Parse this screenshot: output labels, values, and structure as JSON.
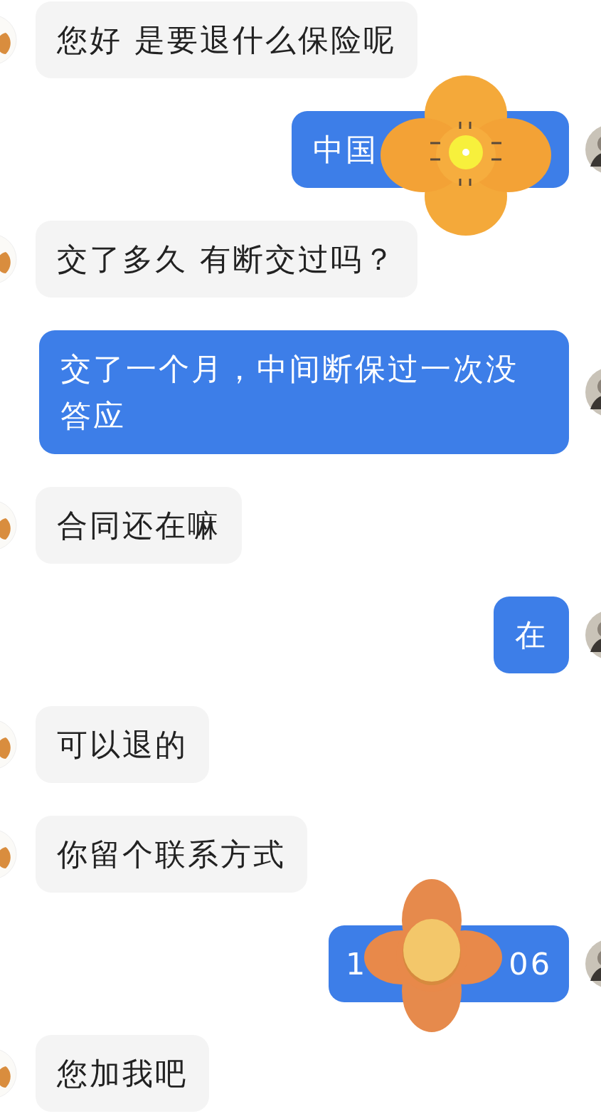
{
  "messages": [
    {
      "kind": "incoming",
      "parts": [
        "您好 是要退什么保险呢"
      ]
    },
    {
      "kind": "outgoing",
      "parts": [
        "中国"
      ],
      "sticker": {
        "kind": "sketch"
      }
    },
    {
      "kind": "incoming",
      "parts": [
        "交了多久 有断交过吗？"
      ]
    },
    {
      "kind": "outgoing",
      "parts": [
        "交了一个月，中间断保过一次没答应"
      ]
    },
    {
      "kind": "incoming",
      "parts": [
        "合同还在嘛"
      ]
    },
    {
      "kind": "outgoing",
      "parts": [
        "在"
      ]
    },
    {
      "kind": "incoming",
      "parts": [
        "可以退的"
      ]
    },
    {
      "kind": "incoming",
      "parts": [
        "你留个联系方式"
      ]
    },
    {
      "kind": "outgoing",
      "parts": [
        "1",
        "06"
      ],
      "sticker": {
        "kind": "clay"
      }
    },
    {
      "kind": "incoming",
      "parts": [
        "您加我吧"
      ]
    }
  ]
}
